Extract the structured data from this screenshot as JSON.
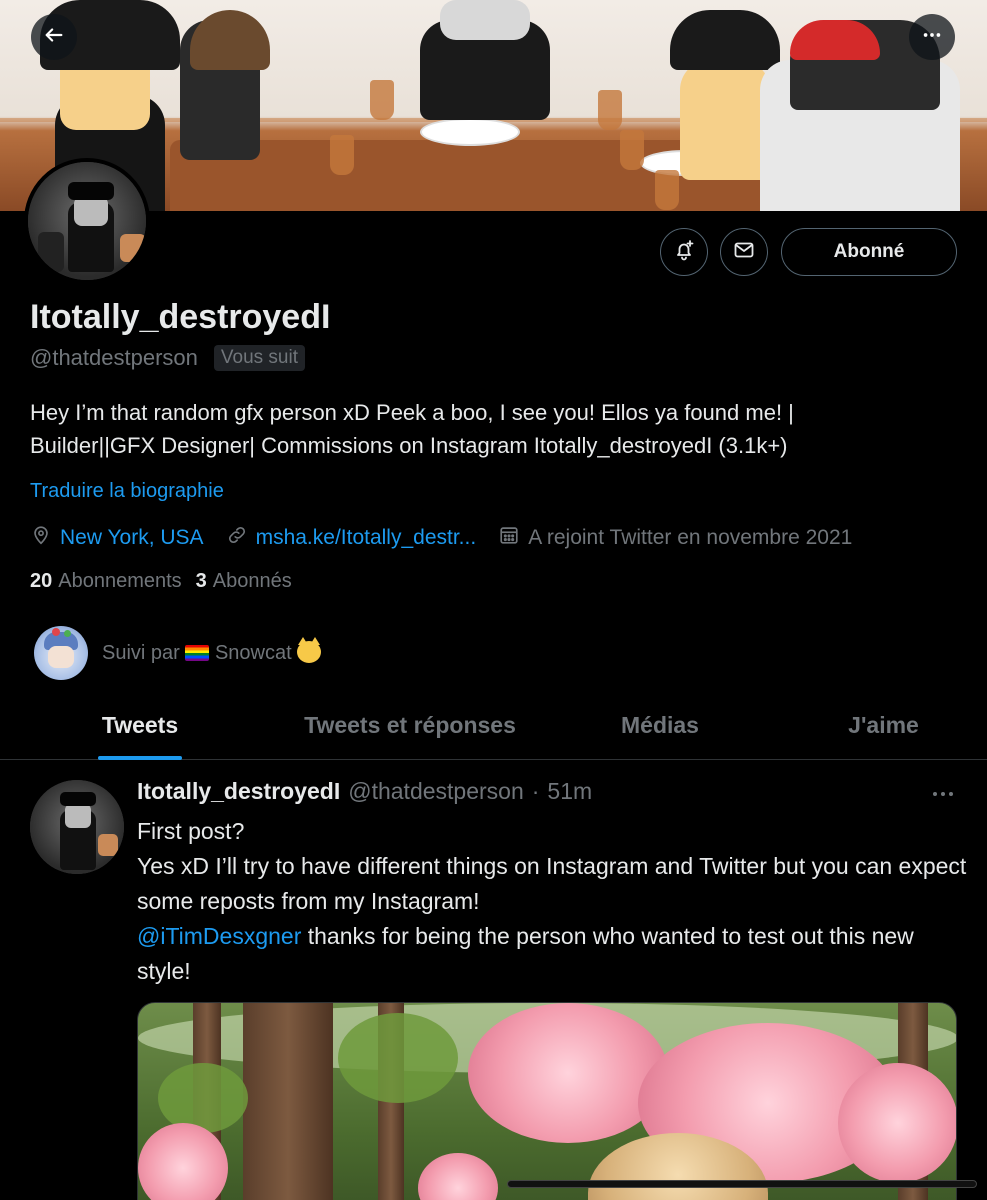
{
  "header": {
    "back_icon": "arrow-left-icon",
    "more_icon": "ellipsis-icon"
  },
  "actions": {
    "notify_icon": "bell-plus-icon",
    "message_icon": "envelope-icon",
    "follow_label": "Abonné"
  },
  "profile": {
    "display_name": "Itotally_destroyedI",
    "handle": "@thatdestperson",
    "follows_you": "Vous suit",
    "bio_line1": "Hey I’m that random gfx person xD Peek a boo, I see you! Ellos ya found me! |",
    "bio_line2": "Builder||GFX Designer| Commissions on Instagram Itotally_destroyedI (3.1k+)",
    "translate_label": "Traduire la biographie",
    "location": "New York, USA",
    "website": "msha.ke/Itotally_destr...",
    "joined": "A rejoint Twitter en novembre 2021",
    "following_count": "20",
    "following_label": "Abonnements",
    "followers_count": "3",
    "followers_label": "Abonnés"
  },
  "followed_by": {
    "prefix": "Suivi par",
    "name": "Snowcat"
  },
  "tabs": [
    {
      "label": "Tweets",
      "active": true
    },
    {
      "label": "Tweets et réponses",
      "active": false
    },
    {
      "label": "Médias",
      "active": false
    },
    {
      "label": "J'aime",
      "active": false
    }
  ],
  "tweet": {
    "name": "Itotally_destroyedI",
    "handle": "@thatdestperson",
    "separator": "·",
    "time": "51m",
    "line1": "First post?",
    "line2": "Yes xD I’ll try to have different things on Instagram and Twitter but you can expect some reposts from my Instagram!",
    "mention": "@iTimDesxgner",
    "line3_rest": " thanks for being the person who wanted to test out this new style!"
  },
  "colors": {
    "background": "#000000",
    "text": "#e7e9ea",
    "secondary": "#71767b",
    "accent": "#1d9bf0",
    "border": "#2f3336"
  }
}
